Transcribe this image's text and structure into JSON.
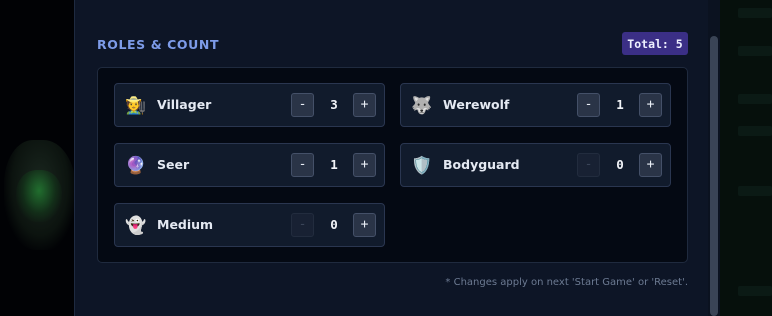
{
  "section": {
    "title": "ROLES & COUNT",
    "total_label": "Total: 5"
  },
  "roles": [
    {
      "name": "Villager",
      "icon": "farmer-icon",
      "glyph": "🧑‍🌾",
      "count": "3",
      "minus_label": "-",
      "plus_label": "+",
      "minus_enabled": true
    },
    {
      "name": "Werewolf",
      "icon": "wolf-icon",
      "glyph": "🐺",
      "count": "1",
      "minus_label": "-",
      "plus_label": "+",
      "minus_enabled": true
    },
    {
      "name": "Seer",
      "icon": "crystal-ball-icon",
      "glyph": "🔮",
      "count": "1",
      "minus_label": "-",
      "plus_label": "+",
      "minus_enabled": true
    },
    {
      "name": "Bodyguard",
      "icon": "shield-icon",
      "glyph": "🛡️",
      "count": "0",
      "minus_label": "-",
      "plus_label": "+",
      "minus_enabled": false
    },
    {
      "name": "Medium",
      "icon": "ghost-icon",
      "glyph": "👻",
      "count": "0",
      "minus_label": "-",
      "plus_label": "+",
      "minus_enabled": false
    }
  ],
  "footnote": "* Changes apply on next 'Start Game' or 'Reset'.",
  "colors": {
    "accent": "#7d9be8",
    "badge": "#3b2f86",
    "panel": "#0d1526"
  }
}
